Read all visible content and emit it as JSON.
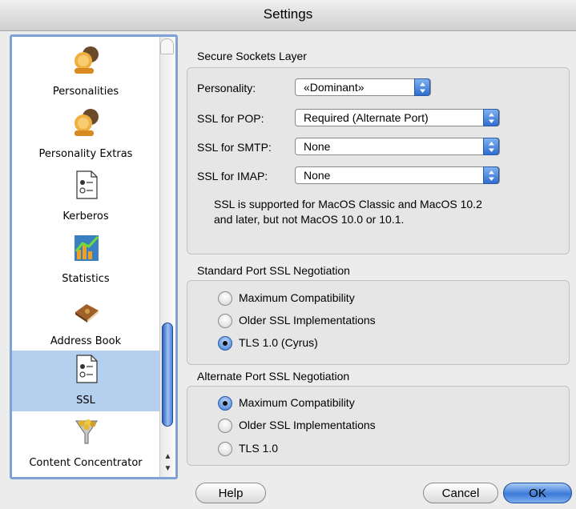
{
  "window": {
    "title": "Settings"
  },
  "sidebar": {
    "items": [
      {
        "label": "Personalities",
        "icon": "personalities-icon",
        "selected": false
      },
      {
        "label": "Personality Extras",
        "icon": "personality-extras-icon",
        "selected": false
      },
      {
        "label": "Kerberos",
        "icon": "kerberos-icon",
        "selected": false
      },
      {
        "label": "Statistics",
        "icon": "statistics-icon",
        "selected": false
      },
      {
        "label": "Address Book",
        "icon": "address-book-icon",
        "selected": false
      },
      {
        "label": "SSL",
        "icon": "ssl-icon",
        "selected": true
      },
      {
        "label": "Content Concentrator",
        "icon": "content-concentrator-icon",
        "selected": false
      }
    ]
  },
  "ssl_group": {
    "title": "Secure Sockets Layer",
    "personality": {
      "label": "Personality:",
      "value": "«Dominant»"
    },
    "pop": {
      "label": "SSL for POP:",
      "value": "Required (Alternate Port)"
    },
    "smtp": {
      "label": "SSL for SMTP:",
      "value": "None"
    },
    "imap": {
      "label": "SSL for IMAP:",
      "value": "None"
    },
    "note": "SSL is supported for MacOS Classic and MacOS 10.2 and later, but not MacOS 10.0 or 10.1."
  },
  "standard_port": {
    "title": "Standard Port SSL Negotiation",
    "options": [
      "Maximum Compatibility",
      "Older SSL Implementations",
      "TLS 1.0 (Cyrus)"
    ],
    "selected": "TLS 1.0 (Cyrus)"
  },
  "alternate_port": {
    "title": "Alternate Port SSL Negotiation",
    "options": [
      "Maximum Compatibility",
      "Older SSL Implementations",
      "TLS 1.0"
    ],
    "selected": "Maximum Compatibility"
  },
  "buttons": {
    "help": "Help",
    "cancel": "Cancel",
    "ok": "OK"
  },
  "colors": {
    "accent": "#3b7ad8",
    "selection": "#b5d0ef"
  }
}
